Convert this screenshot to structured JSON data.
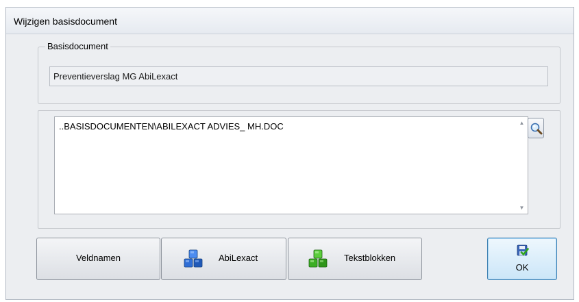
{
  "window": {
    "title": "Wijzigen basisdocument"
  },
  "basisdocument": {
    "legend": "Basisdocument",
    "value": "Preventieverslag MG AbiLexact"
  },
  "path_field": {
    "value": "..BASISDOCUMENTEN\\ABILEXACT ADVIES_ MH.DOC",
    "browse_icon": "magnifier-icon"
  },
  "buttons": {
    "veldnamen": "Veldnamen",
    "abilexact": "AbiLexact",
    "tekstblokken": "Tekstblokken",
    "ok": "OK"
  },
  "icons": {
    "abilexact": "blue-cubes-icon",
    "tekstblokken": "green-cubes-icon",
    "ok": "save-check-icon"
  },
  "colors": {
    "blue_cubes": "#2f6ed6",
    "green_cubes": "#3cae24",
    "ok_border": "#3c7fb1"
  }
}
